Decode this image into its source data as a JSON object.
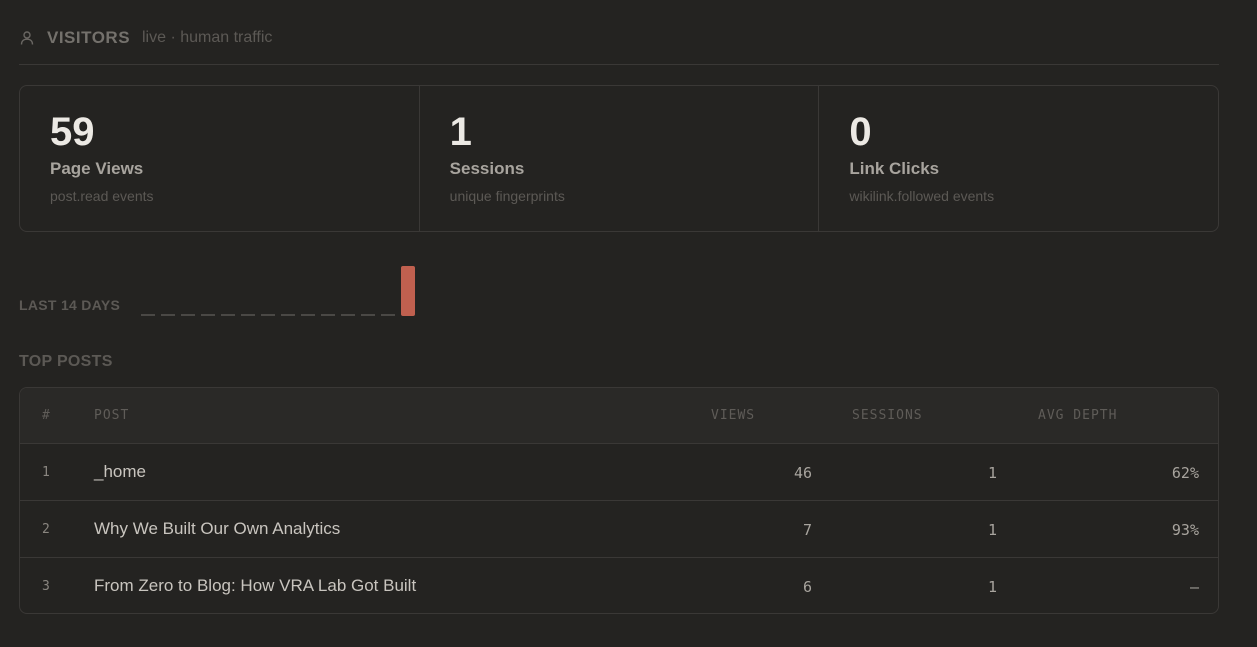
{
  "header": {
    "icon": "user-icon",
    "title": "VISITORS",
    "subtitle": "live · human traffic"
  },
  "stats": [
    {
      "value": "59",
      "label": "Page Views",
      "desc": "post.read events"
    },
    {
      "value": "1",
      "label": "Sessions",
      "desc": "unique fingerprints"
    },
    {
      "value": "0",
      "label": "Link Clicks",
      "desc": "wikilink.followed events"
    }
  ],
  "sparkline": {
    "label": "LAST 14 DAYS",
    "values": [
      0,
      0,
      0,
      0,
      0,
      0,
      0,
      0,
      0,
      0,
      0,
      0,
      0,
      59
    ],
    "bar_color": "#c0604f",
    "empty_color": "#4a4845"
  },
  "top_posts": {
    "title": "TOP POSTS",
    "columns": {
      "rank": "#",
      "post": "POST",
      "views": "VIEWS",
      "sessions": "SESSIONS",
      "avg_depth": "AVG DEPTH"
    },
    "rows": [
      {
        "rank": "1",
        "post": "_home",
        "views": "46",
        "sessions": "1",
        "avg_depth": "62%"
      },
      {
        "rank": "2",
        "post": "Why We Built Our Own Analytics",
        "views": "7",
        "sessions": "1",
        "avg_depth": "93%"
      },
      {
        "rank": "3",
        "post": "From Zero to Blog: How VRA Lab Got Built",
        "views": "6",
        "sessions": "1",
        "avg_depth": "–"
      }
    ]
  }
}
